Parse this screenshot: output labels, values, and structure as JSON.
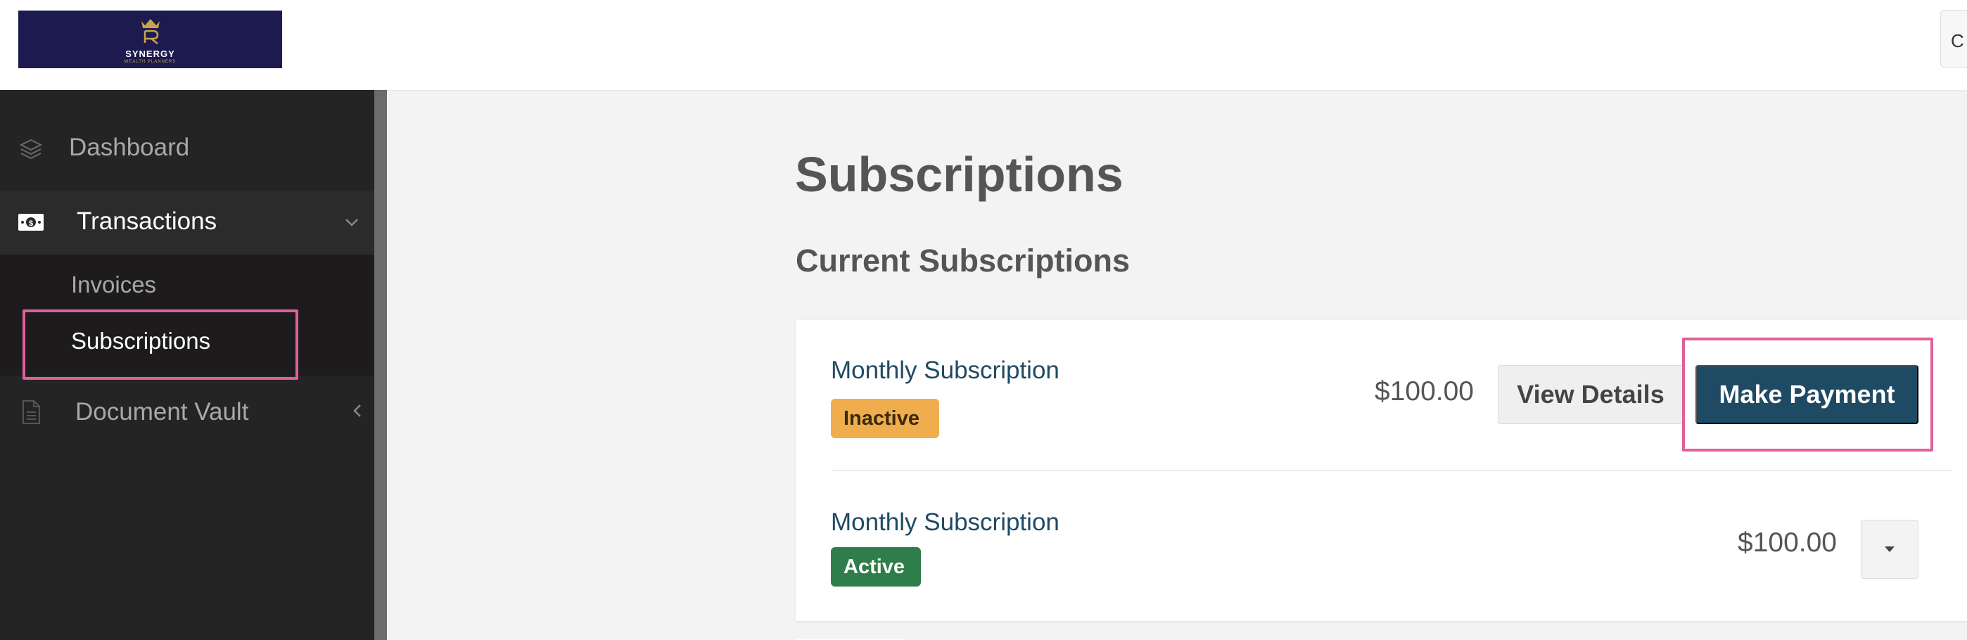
{
  "brand": {
    "name": "SYNERGY",
    "tagline": "WEALTH PLANNERS",
    "logo_bg": "#1c1a4e",
    "logo_accent": "#c9a24a"
  },
  "topbar": {
    "right_button_partial": "C"
  },
  "sidebar": {
    "items": [
      {
        "label": "Dashboard",
        "icon": "layers-icon"
      },
      {
        "label": "Transactions",
        "icon": "money-icon",
        "expanded": true
      },
      {
        "label": "Document Vault",
        "icon": "document-icon",
        "expanded": false
      }
    ],
    "transactions_submenu": [
      {
        "label": "Invoices",
        "active": false
      },
      {
        "label": "Subscriptions",
        "active": true
      }
    ]
  },
  "main": {
    "title": "Subscriptions",
    "section_title": "Current Subscriptions",
    "subscriptions": [
      {
        "name": "Monthly Subscription",
        "status": "Inactive",
        "price": "$100.00",
        "view_details_label": "View Details",
        "make_payment_label": "Make Payment"
      },
      {
        "name": "Monthly Subscription",
        "status": "Active",
        "price": "$100.00"
      }
    ]
  },
  "colors": {
    "primary": "#1f4a63",
    "inactive_badge": "#f0ad4e",
    "active_badge": "#2f7d4a",
    "sidebar_bg": "#242424",
    "highlight": "#e0609a"
  }
}
